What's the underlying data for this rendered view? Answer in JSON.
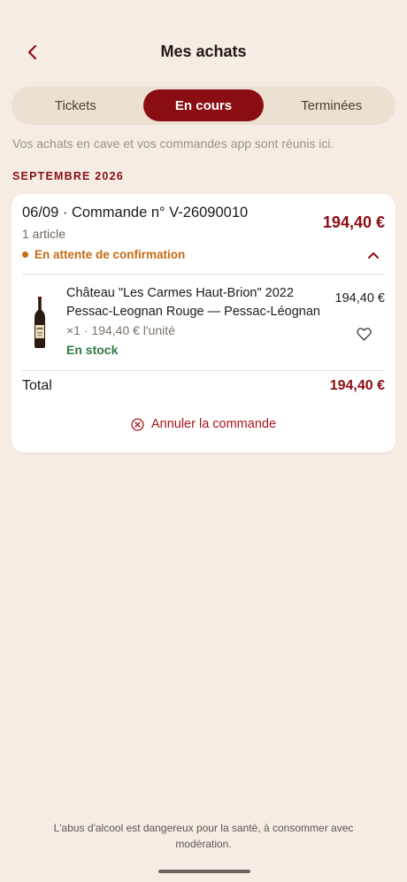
{
  "header": {
    "title": "Mes achats",
    "back_icon": "chevron-left-icon"
  },
  "tabs": [
    {
      "label": "Tickets",
      "active": false
    },
    {
      "label": "En cours",
      "active": true
    },
    {
      "label": "Terminées",
      "active": false
    }
  ],
  "subtitle": "Vos achats en cave et vos commandes app sont réunis ici.",
  "month_heading": "SEPTEMBRE 2026",
  "order": {
    "title": "06/09 · Commande n° V-26090010",
    "count": "1 article",
    "status": "En attente de confirmation",
    "total_top": "194,40 €",
    "item": {
      "name_line1": "Château \"Les Carmes Haut-Brion\" 2022",
      "name_line2": "Pessac-Leognan Rouge — Pessac-Léognan",
      "qty": "×1 · 194,40 € l'unité",
      "stock": "En stock",
      "price": "194,40 €"
    },
    "total_label": "Total",
    "total_value": "194,40 €",
    "cancel_label": "Annuler la commande"
  },
  "footer_note": "L'abus d'alcool est dangereux pour la santé, à consommer avec modération.",
  "colors": {
    "background": "#f5ede4",
    "brand": "#8b0d14",
    "status_pending": "#c86a12",
    "in_stock": "#2f7a45"
  }
}
